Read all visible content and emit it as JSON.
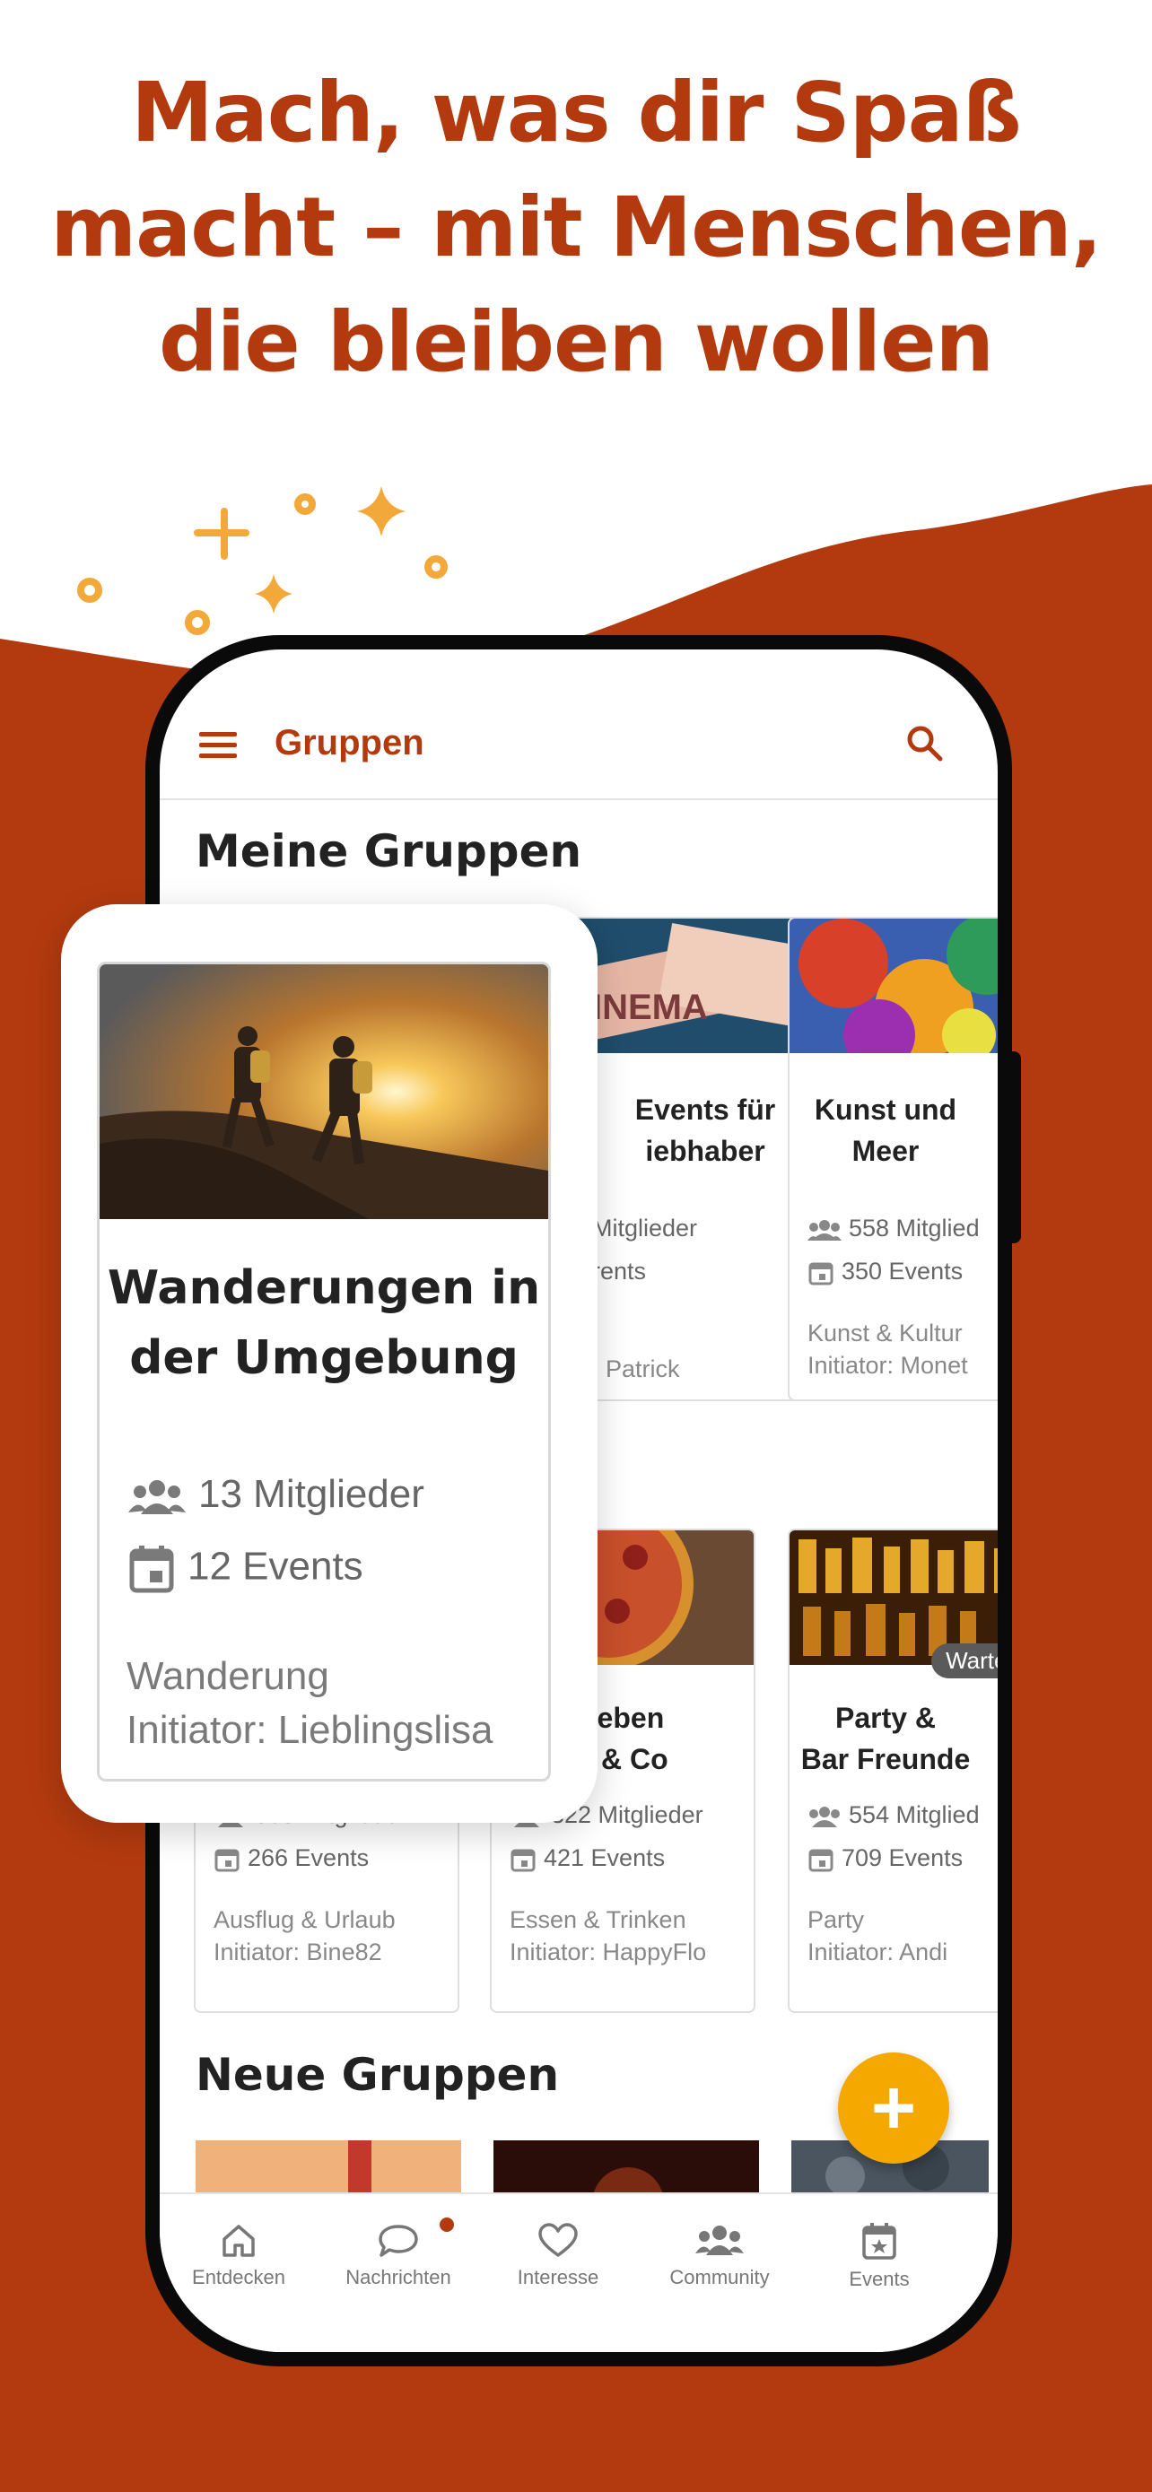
{
  "headline": {
    "line1": "Mach, was dir Spaß",
    "line2": "macht – mit Menschen,",
    "line3": "die bleiben wollen"
  },
  "colors": {
    "brand": "#b33a0e",
    "accent": "#f5a800"
  },
  "app": {
    "title": "Gruppen",
    "menu_icon": "hamburger-menu-icon",
    "search_icon": "search-icon"
  },
  "sections": {
    "my_groups": "Meine Gruppen",
    "new_groups": "Neue Gruppen"
  },
  "featured_card": {
    "title_line1": "Wanderungen in",
    "title_line2": "der Umgebung",
    "members": "13 Mitglieder",
    "events": "12 Events",
    "category": "Wanderung",
    "initiator": "Initiator: Lieblingslisa"
  },
  "my_groups_row1": [
    {
      "title_line1": "Events für",
      "title_line2": "iebhaber",
      "members": "Mitglieder",
      "events": "rents",
      "category": "",
      "initiator": ": Patrick"
    },
    {
      "title_line1": "Kunst und",
      "title_line2": "Meer",
      "members": "558 Mitglied",
      "events": "350 Events",
      "category": "Kunst & Kultur",
      "initiator": "Initiator: Monet"
    }
  ],
  "my_groups_row2": [
    {
      "title_line1": "",
      "title_line2": "",
      "members": "858 Mitglieder",
      "events": "266 Events",
      "category": "Ausflug & Urlaub",
      "initiator": "Initiator: Bine82"
    },
    {
      "title_line1": "lieben",
      "title_line2": "a & Co",
      "members": "322 Mitglieder",
      "events": "421 Events",
      "category": "Essen & Trinken",
      "initiator": "Initiator: HappyFlo"
    },
    {
      "title_line1": "Party &",
      "title_line2": "Bar Freunde",
      "members": "554 Mitglied",
      "events": "709 Events",
      "category": "Party",
      "initiator": "Initiator: Andi",
      "badge": "Warteli"
    }
  ],
  "fab": {
    "label": "+"
  },
  "bottom_nav": [
    {
      "label": "Entdecken",
      "icon": "home-icon"
    },
    {
      "label": "Nachrichten",
      "icon": "chat-bubble-icon"
    },
    {
      "label": "Interesse",
      "icon": "heart-icon"
    },
    {
      "label": "Community",
      "icon": "people-icon"
    },
    {
      "label": "Events",
      "icon": "calendar-icon"
    }
  ]
}
